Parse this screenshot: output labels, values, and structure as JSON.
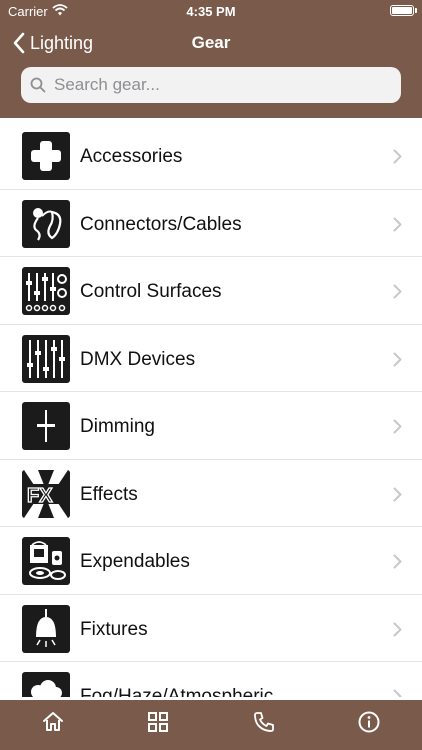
{
  "status": {
    "carrier": "Carrier",
    "time": "4:35 PM"
  },
  "nav": {
    "back_label": "Lighting",
    "title": "Gear"
  },
  "search": {
    "placeholder": "Search gear..."
  },
  "items": [
    {
      "label": "Accessories",
      "icon": "plus-icon"
    },
    {
      "label": "Connectors/Cables",
      "icon": "cable-icon"
    },
    {
      "label": "Control Surfaces",
      "icon": "faders-icon"
    },
    {
      "label": "DMX Devices",
      "icon": "dmx-icon"
    },
    {
      "label": "Dimming",
      "icon": "dimmer-icon"
    },
    {
      "label": "Effects",
      "icon": "fx-icon"
    },
    {
      "label": "Expendables",
      "icon": "paint-can-icon"
    },
    {
      "label": "Fixtures",
      "icon": "lamp-icon"
    },
    {
      "label": "Fog/Haze/Atmospheric",
      "icon": "fog-icon"
    }
  ],
  "tabs": [
    {
      "icon": "home-icon"
    },
    {
      "icon": "grid-icon"
    },
    {
      "icon": "phone-icon"
    },
    {
      "icon": "info-icon"
    }
  ],
  "colors": {
    "bar": "#7a5a4b",
    "icon_bg": "#1b1b1b",
    "search_bg": "#f2f2f2"
  }
}
